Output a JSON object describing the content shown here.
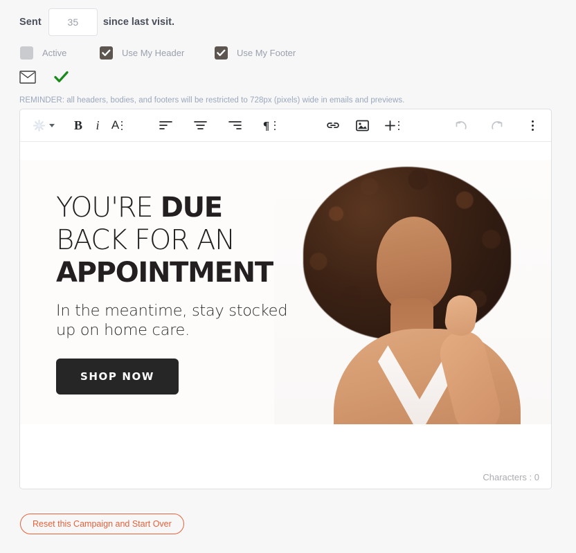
{
  "form": {
    "sent_label": "Sent",
    "sent_value": "35",
    "sent_suffix": "since last visit.",
    "checkboxes": [
      {
        "label": "Active",
        "checked": false,
        "icon": "checkbox-unchecked-icon"
      },
      {
        "label": "Use My Header",
        "checked": true,
        "icon": "checkbox-checked-icon"
      },
      {
        "label": "Use My Footer",
        "checked": true,
        "icon": "checkbox-checked-icon"
      }
    ],
    "status_icons": [
      {
        "name": "envelope-icon"
      },
      {
        "name": "green-check-icon"
      }
    ],
    "reminder": "REMINDER: all headers, bodies, and footers will be restricted to 728px (pixels) wide in emails and previews."
  },
  "editor": {
    "toolbar": {
      "style_label": "styles-icon",
      "bold_label": "B",
      "italic_label": "i",
      "font_label": "A",
      "items": [
        {
          "name": "styles-dropdown",
          "icon": "asterisk-styles-icon"
        },
        {
          "name": "bold-button",
          "icon": "bold-icon"
        },
        {
          "name": "italic-button",
          "icon": "italic-icon"
        },
        {
          "name": "font-options-button",
          "icon": "font-size-icon"
        },
        {
          "name": "align-left-button",
          "icon": "align-left-icon"
        },
        {
          "name": "align-center-button",
          "icon": "align-center-icon"
        },
        {
          "name": "align-right-button",
          "icon": "align-right-icon"
        },
        {
          "name": "paragraph-format-button",
          "icon": "paragraph-icon"
        },
        {
          "name": "insert-link-button",
          "icon": "link-icon"
        },
        {
          "name": "insert-image-button",
          "icon": "image-icon"
        },
        {
          "name": "insert-more-button",
          "icon": "plus-icon"
        },
        {
          "name": "undo-button",
          "icon": "undo-icon"
        },
        {
          "name": "redo-button",
          "icon": "redo-icon"
        },
        {
          "name": "more-options-button",
          "icon": "vertical-dots-icon"
        }
      ]
    },
    "banner": {
      "headline_line1_light": "YOU'RE ",
      "headline_line1_bold": "DUE",
      "headline_line2_light": "BACK FOR AN",
      "headline_line3_bold": "APPOINTMENT",
      "subtext_line1": "In the meantime, stay stocked",
      "subtext_line2": "up on home care.",
      "cta_label": "SHOP NOW",
      "photo_alt": "woman-with-curly-hair-photo"
    },
    "character_count": "Characters : 0"
  },
  "footer": {
    "reset_label": "Reset this Campaign and Start Over"
  },
  "colors": {
    "accent_orange": "#e7613a",
    "checkbox_checked": "#5d5550",
    "checkbox_unchecked": "#c9cbcf",
    "green_check": "#1a8a1a",
    "page_background": "#f7f7f8",
    "cta_dark": "#262626"
  }
}
